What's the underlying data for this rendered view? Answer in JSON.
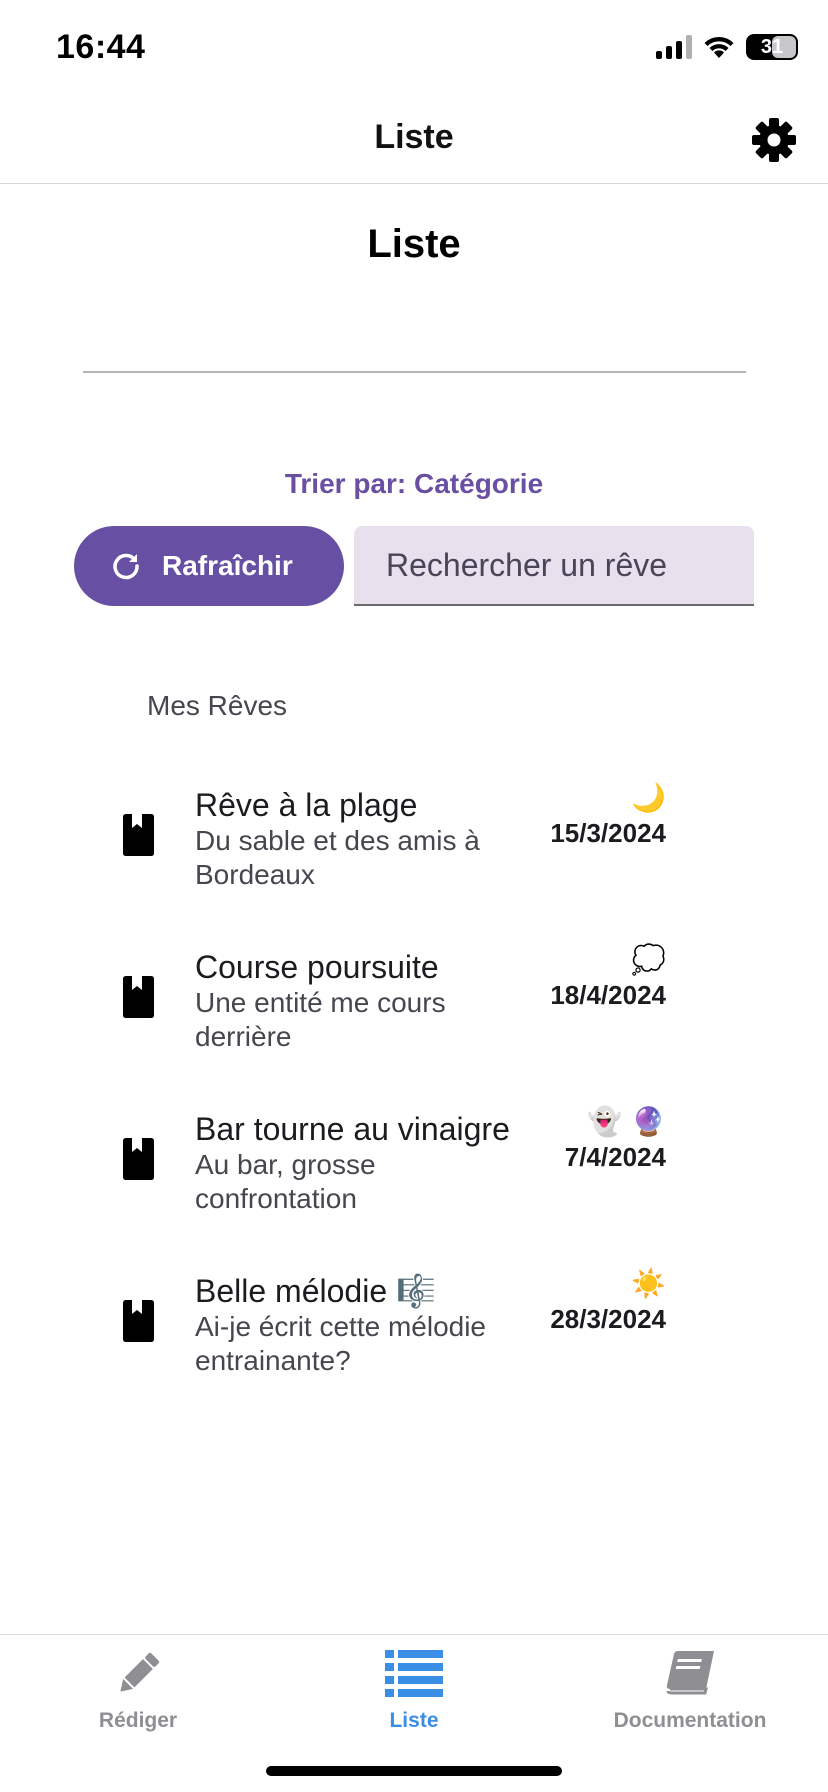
{
  "status_bar": {
    "time": "16:44",
    "battery": "31"
  },
  "header": {
    "title": "Liste",
    "settings_icon": "gear-icon"
  },
  "page": {
    "title": "Liste"
  },
  "controls": {
    "sort_label": "Trier par: Catégorie",
    "refresh_label": "Rafraîchir",
    "search_placeholder": "Rechercher un rêve"
  },
  "section": {
    "label": "Mes Rêves"
  },
  "dreams": [
    {
      "title": "Rêve à la plage",
      "description": "Du sable et des amis à Bordeaux",
      "emoji": "🌙",
      "date": "15/3/2024"
    },
    {
      "title": "Course poursuite",
      "description": "Une entité me cours derrière",
      "emoji": "💭",
      "date": "18/4/2024"
    },
    {
      "title": "Bar tourne au vinaigre",
      "description": "Au bar, grosse confrontation",
      "emoji": "👻 🔮",
      "date": "7/4/2024"
    },
    {
      "title": "Belle mélodie 🎼",
      "description": "Ai-je écrit cette mélodie entrainante?",
      "emoji": "☀️",
      "date": "28/3/2024"
    }
  ],
  "tabs": [
    {
      "label": "Rédiger",
      "icon": "pencil-icon",
      "active": false
    },
    {
      "label": "Liste",
      "icon": "list-icon",
      "active": true
    },
    {
      "label": "Documentation",
      "icon": "book-icon",
      "active": false
    }
  ],
  "colors": {
    "accent": "#6750a4",
    "tab_active": "#3a8ee6",
    "tab_inactive": "#8e8e93"
  }
}
